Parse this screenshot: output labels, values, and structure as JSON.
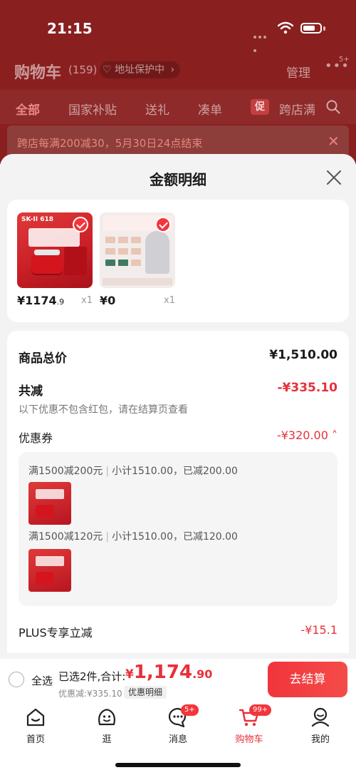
{
  "status_bar": {
    "time": "21:15"
  },
  "cart_header": {
    "title": "购物车",
    "count": "(159)",
    "address_protect": "地址保护中",
    "manage": "管理",
    "more_badge": "5+"
  },
  "tabs": [
    {
      "label": "全部"
    },
    {
      "label": "国家补贴"
    },
    {
      "label": "送礼"
    },
    {
      "label": "凑单"
    },
    {
      "label": "跨店满"
    }
  ],
  "promo_tag": "促",
  "promo_banner": {
    "text": "跨店每满200减30，5月30日24点结束"
  },
  "sheet": {
    "title": "金额明细",
    "products": [
      {
        "price_main": "¥1174",
        "price_dec": ".9",
        "qty": "x1",
        "brand": "SK-II 618"
      },
      {
        "price_main": "¥0",
        "price_dec": "",
        "qty": "x1",
        "brand": ""
      }
    ],
    "total_label": "商品总价",
    "total_value": "¥1,510.00",
    "reduce_label": "共减",
    "reduce_value": "-¥335.10",
    "reduce_note": "以下优惠不包含红包，请在结算页查看",
    "coupon_label": "优惠券",
    "coupon_value": "-¥320.00",
    "coupons": [
      {
        "rule": "满1500减200元",
        "detail": "小计1510.00，已减200.00"
      },
      {
        "rule": "满1500减120元",
        "detail": "小计1510.00，已减120.00"
      }
    ],
    "plus_label": "PLUS专享立减",
    "plus_value": "-¥15.1"
  },
  "checkout": {
    "select_all": "全选",
    "selected_text": "已选2件,合计:",
    "total_yen": "¥",
    "total_int": "1,174",
    "total_dec": ".90",
    "discount_text": "优惠减:¥335.10",
    "detail_pill": "优惠明细",
    "button": "去结算"
  },
  "bottom_nav": [
    {
      "label": "首页",
      "icon": "home-icon",
      "badge": ""
    },
    {
      "label": "逛",
      "icon": "browse-icon",
      "badge": ""
    },
    {
      "label": "消息",
      "icon": "message-icon",
      "badge": "5+"
    },
    {
      "label": "购物车",
      "icon": "cart-icon",
      "badge": "99+"
    },
    {
      "label": "我的",
      "icon": "profile-icon",
      "badge": ""
    }
  ],
  "colors": {
    "accent": "#e8303a",
    "header_bg": "#8a1f1f"
  }
}
